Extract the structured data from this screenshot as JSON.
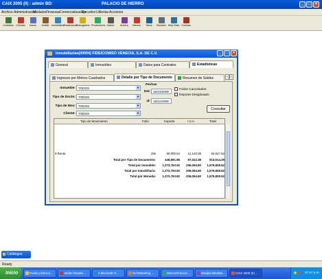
{
  "app": {
    "title": "CAIX  2005 (II) : admin    BD:",
    "subtitle": "PALACIO DE HIERRO",
    "menu": [
      "Archivo",
      "Administración",
      "Módulos",
      "Finanzas",
      "Comercialización",
      "Ejecutivo",
      "Utilerias",
      "Acciones"
    ],
    "toolbar": [
      "Contratos",
      "Clientes",
      "Inmue",
      "Inmble",
      "Inmobiliaria",
      "Estadísticas",
      "Planograma",
      "Proveedores",
      "Jobber",
      "Archivo",
      "Macros",
      "Tarea",
      "Escanéo",
      "Help Desk",
      "Cuentas"
    ]
  },
  "dialog": {
    "title": "Inmobiliarias(00004) FIDEICOMISO VENECIA, S.A. DE C.V.",
    "tabs_row1": [
      "General",
      "Inmuebles",
      "Datos para Contratos",
      "Estadisticas"
    ],
    "tabs_row2": [
      "Ingresos por Metros Cuadrados",
      "Detalle por Tipo de Documento",
      "Resumen de Saldos"
    ],
    "filters": {
      "inmueble_label": "Inmueble:",
      "inmueble_value": "TODOS",
      "tipo_docto_label": "Tipo de Docto:",
      "tipo_docto_value": "TODOS",
      "tipo_mov_label": "Tipo de Mov:",
      "tipo_mov_value": "TODOS",
      "cliente_label": "Cliente:",
      "cliente_value": "TODOS",
      "fechas_label": "Fechas",
      "del_label": "Del:",
      "del_value": "16/10/2008",
      "al_label": "al:",
      "al_value": "15/11/2008",
      "folios_cancelados": "Folios Cancelados",
      "reporte_desglosado": "Reporte Desglosado",
      "consultar": "Consultar"
    },
    "grid": {
      "headers": [
        "Tipo de Movimiento",
        "Folio",
        "Importe",
        "I.V.A.",
        "Total"
      ],
      "row": {
        "tipo": "9 Renta",
        "folio": "206",
        "importe": "80,800.54",
        "iva": "12,120.08",
        "total": "92,927.52"
      },
      "totals": [
        {
          "label": "Total por Tipo de Documento:",
          "importe": "446,891.96",
          "iva": "67,022.38",
          "total": "513,914.29"
        },
        {
          "label": "Total por Inmueble:",
          "importe": "1,373,763.92",
          "iva": "206,064.60",
          "total": "1,579,828.52"
        },
        {
          "label": "Total por Inmobiliaria:",
          "importe": "1,373,763.92",
          "iva": "206,064.60",
          "total": "1,579,828.52"
        },
        {
          "label": "Total por Moneda:",
          "importe": "1,373,763.92",
          "iva": "206,064.60",
          "total": "1,579,828.52"
        }
      ]
    }
  },
  "catalogos": "Catálogos",
  "status": "Ready",
  "taskbar": {
    "start": "Inicio",
    "tasks": [
      "Portal y Estruct...",
      "Adobe Reader ...",
      "2 Microsoft O...",
      "GoToMeeting ...",
      "Microsoft Excel ...",
      "Mindjet MindMa...",
      "CAIX 2005 (II) ..."
    ],
    "clock": "07:57 p.m."
  },
  "colors": {
    "titlebar": "#0a5bd9",
    "dialog_bg": "#ece9d8",
    "taskbar": "#245edb",
    "start": "#3c9b3c"
  }
}
